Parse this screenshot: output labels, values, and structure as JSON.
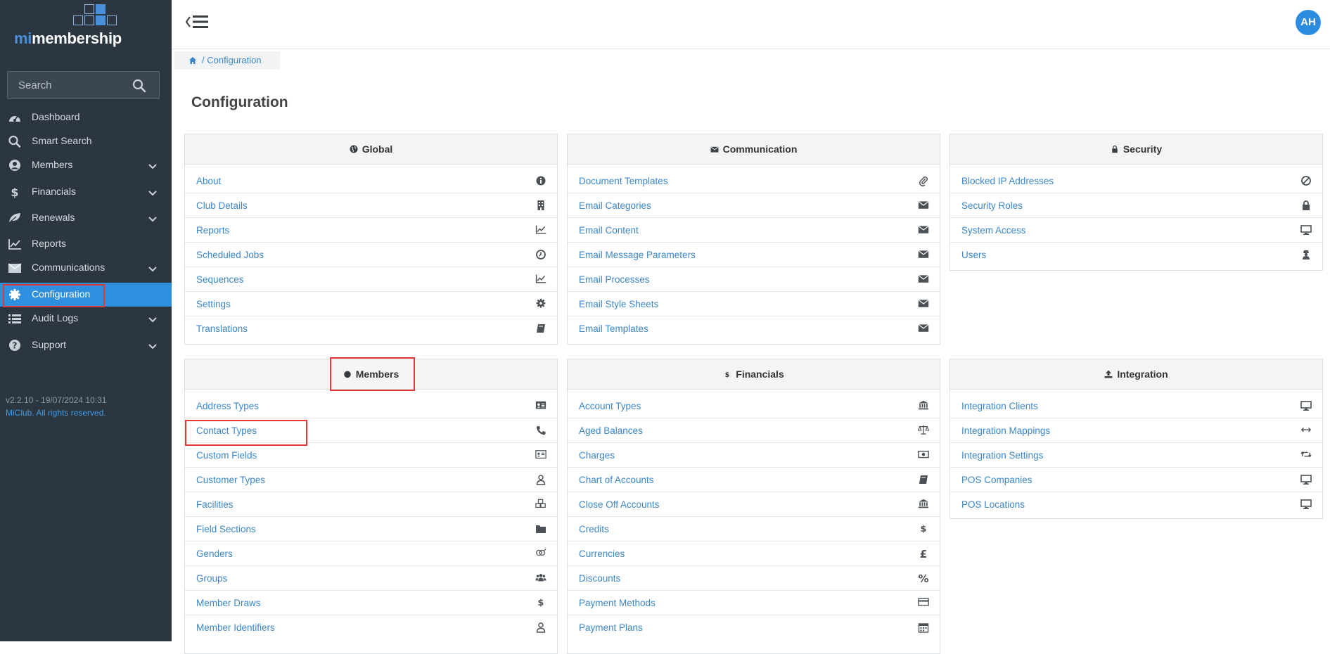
{
  "app": {
    "logo_prefix": "mi",
    "logo_suffix": "membership"
  },
  "sidebar": {
    "search_placeholder": "Search",
    "items": [
      {
        "label": "Dashboard",
        "icon": "dashboard-icon",
        "chevron": false
      },
      {
        "label": "Smart Search",
        "icon": "search-icon",
        "chevron": false
      },
      {
        "label": "Members",
        "icon": "user-circle-icon",
        "chevron": true
      },
      {
        "label": "Financials",
        "icon": "dollar-icon",
        "chevron": true
      },
      {
        "label": "Renewals",
        "icon": "leaf-icon",
        "chevron": true
      },
      {
        "label": "Reports",
        "icon": "line-chart-icon",
        "chevron": false
      },
      {
        "label": "Communications",
        "icon": "envelope-icon",
        "chevron": true
      },
      {
        "label": "Configuration",
        "icon": "gear-icon",
        "chevron": false,
        "active": true
      },
      {
        "label": "Audit Logs",
        "icon": "list-icon",
        "chevron": true
      },
      {
        "label": "Support",
        "icon": "question-circle-icon",
        "chevron": true
      }
    ],
    "version": "v2.2.10 - 19/07/2024 10:31",
    "copyright": "MiClub. All rights reserved."
  },
  "header": {
    "avatar_initials": "AH"
  },
  "breadcrumb": {
    "separator_text": "/ Configuration"
  },
  "page_title": "Configuration",
  "panels": {
    "global": {
      "title": "Global",
      "items": [
        {
          "label": "About",
          "icon": "info-icon"
        },
        {
          "label": "Club Details",
          "icon": "building-icon"
        },
        {
          "label": "Reports",
          "icon": "line-chart-icon"
        },
        {
          "label": "Scheduled Jobs",
          "icon": "clock-icon"
        },
        {
          "label": "Sequences",
          "icon": "line-chart-icon"
        },
        {
          "label": "Settings",
          "icon": "gear-icon"
        },
        {
          "label": "Translations",
          "icon": "book-icon"
        }
      ]
    },
    "communication": {
      "title": "Communication",
      "items": [
        {
          "label": "Document Templates",
          "icon": "paperclip-icon"
        },
        {
          "label": "Email Categories",
          "icon": "envelope-icon"
        },
        {
          "label": "Email Content",
          "icon": "envelope-icon"
        },
        {
          "label": "Email Message Parameters",
          "icon": "envelope-icon"
        },
        {
          "label": "Email Processes",
          "icon": "envelope-icon"
        },
        {
          "label": "Email Style Sheets",
          "icon": "envelope-icon"
        },
        {
          "label": "Email Templates",
          "icon": "envelope-icon"
        }
      ]
    },
    "security": {
      "title": "Security",
      "items": [
        {
          "label": "Blocked IP Addresses",
          "icon": "ban-icon"
        },
        {
          "label": "Security Roles",
          "icon": "lock-icon"
        },
        {
          "label": "System Access",
          "icon": "monitor-icon"
        },
        {
          "label": "Users",
          "icon": "user-secret-icon"
        }
      ]
    },
    "members": {
      "title": "Members",
      "items": [
        {
          "label": "Address Types",
          "icon": "address-card-icon"
        },
        {
          "label": "Contact Types",
          "icon": "phone-icon"
        },
        {
          "label": "Custom Fields",
          "icon": "id-card-icon"
        },
        {
          "label": "Customer Types",
          "icon": "user-outline-icon"
        },
        {
          "label": "Facilities",
          "icon": "cubes-icon"
        },
        {
          "label": "Field Sections",
          "icon": "folder-icon"
        },
        {
          "label": "Genders",
          "icon": "genderless-icon"
        },
        {
          "label": "Groups",
          "icon": "users-icon"
        },
        {
          "label": "Member Draws",
          "icon": "dollar-icon"
        },
        {
          "label": "Member Identifiers",
          "icon": "user-outline-icon"
        }
      ]
    },
    "financials": {
      "title": "Financials",
      "items": [
        {
          "label": "Account Types",
          "icon": "bank-icon"
        },
        {
          "label": "Aged Balances",
          "icon": "balance-scale-icon"
        },
        {
          "label": "Charges",
          "icon": "money-icon"
        },
        {
          "label": "Chart of Accounts",
          "icon": "book-icon"
        },
        {
          "label": "Close Off Accounts",
          "icon": "bank-icon"
        },
        {
          "label": "Credits",
          "icon": "dollar-icon"
        },
        {
          "label": "Currencies",
          "icon": "pound-icon"
        },
        {
          "label": "Discounts",
          "icon": "percent-icon"
        },
        {
          "label": "Payment Methods",
          "icon": "credit-card-icon"
        },
        {
          "label": "Payment Plans",
          "icon": "calendar-icon"
        }
      ]
    },
    "integration": {
      "title": "Integration",
      "items": [
        {
          "label": "Integration Clients",
          "icon": "monitor-icon"
        },
        {
          "label": "Integration Mappings",
          "icon": "arrows-h-icon"
        },
        {
          "label": "Integration Settings",
          "icon": "retweet-icon"
        },
        {
          "label": "POS Companies",
          "icon": "monitor-icon"
        },
        {
          "label": "POS Locations",
          "icon": "monitor-icon"
        }
      ]
    }
  },
  "colors": {
    "sidebar_bg": "#2b3640",
    "accent": "#2f8fdf",
    "link": "#3b86c9",
    "highlight": "#e53935"
  }
}
